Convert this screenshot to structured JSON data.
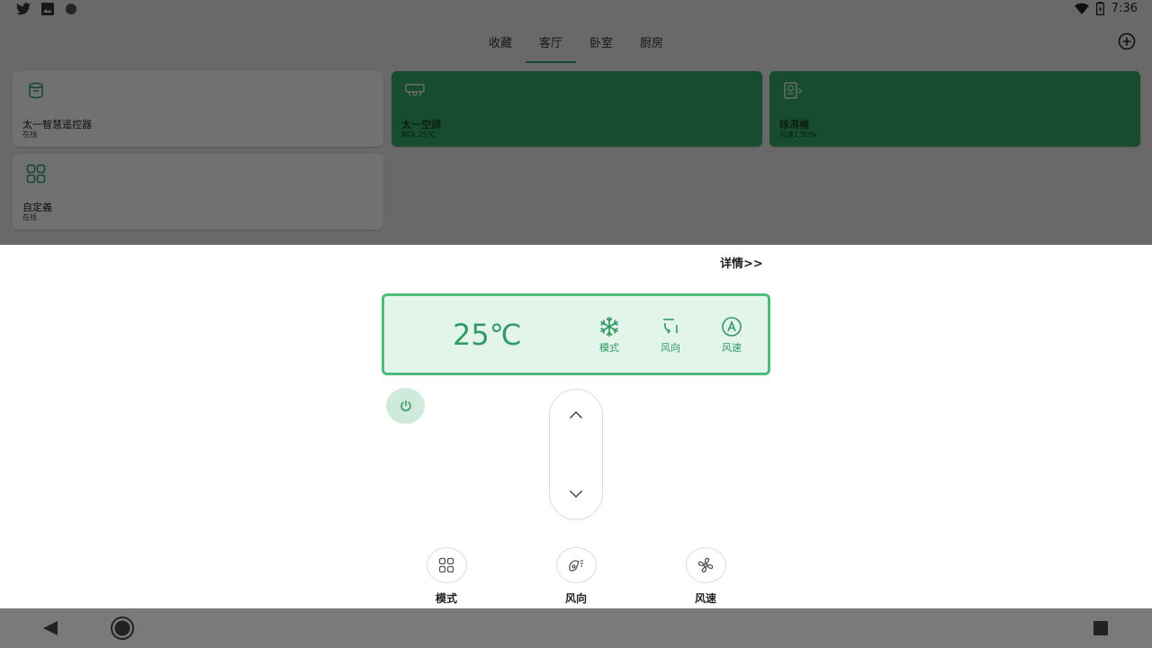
{
  "status_bar": {
    "time": "7:36",
    "left_icons": [
      "twitter-icon",
      "image-icon",
      "circle-icon"
    ],
    "right_icons": [
      "wifi-icon",
      "battery-icon"
    ]
  },
  "tabs": [
    {
      "label": "收藏",
      "active": false
    },
    {
      "label": "客厅",
      "active": true
    },
    {
      "label": "卧室",
      "active": false
    },
    {
      "label": "厨房",
      "active": false
    }
  ],
  "devices": [
    {
      "title": "太一智慧遥控器",
      "subtitle": "在线",
      "icon": "remote-icon",
      "highlighted": false
    },
    {
      "title": "太一空調",
      "subtitle": "制冷 25℃",
      "icon": "air-conditioner-icon",
      "highlighted": true
    },
    {
      "title": "除濕機",
      "subtitle": "风速1 50%",
      "icon": "dehumidifier-icon",
      "highlighted": true
    },
    {
      "title": "自定義",
      "subtitle": "在线",
      "icon": "grid-icon",
      "highlighted": false
    }
  ],
  "sheet": {
    "details_link": "详情>>",
    "display": {
      "temperature": "25℃",
      "mode_label": "模式",
      "direction_label": "风向",
      "speed_label": "风速"
    },
    "controls": [
      {
        "label": "模式",
        "icon": "grid-icon"
      },
      {
        "label": "风向",
        "icon": "wind-direction-icon"
      },
      {
        "label": "风速",
        "icon": "fan-icon"
      }
    ]
  },
  "colors": {
    "accent": "#2f9a63",
    "card_green": "#34a866",
    "display_bg": "#e3f4ea"
  }
}
